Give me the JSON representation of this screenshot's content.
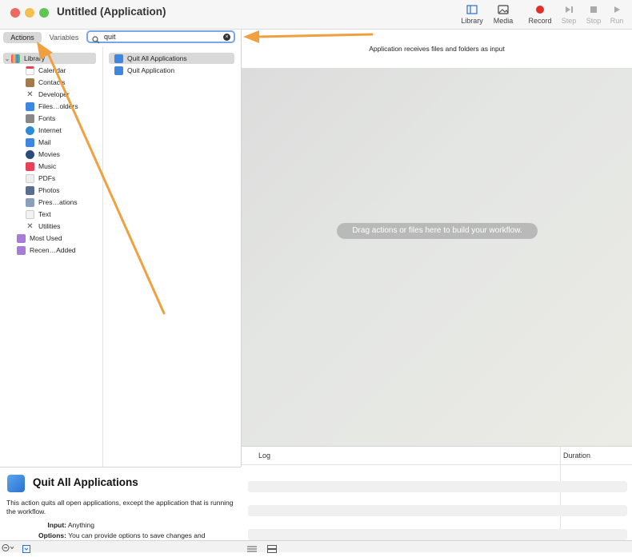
{
  "window": {
    "title": "Untitled (Application)"
  },
  "toolbar": {
    "library": "Library",
    "media": "Media",
    "record": "Record",
    "step": "Step",
    "stop": "Stop",
    "run": "Run"
  },
  "tabs": {
    "actions": "Actions",
    "variables": "Variables"
  },
  "search": {
    "value": "quit"
  },
  "library": {
    "root": "Library",
    "items": [
      {
        "label": "Calendar",
        "icon": "calendar-icon",
        "color": "#ffffff"
      },
      {
        "label": "Contacts",
        "icon": "contacts-icon",
        "color": "#a27a4d"
      },
      {
        "label": "Developer",
        "icon": "tools-icon",
        "color": "#666666"
      },
      {
        "label": "Files…olders",
        "icon": "finder-icon",
        "color": "#3f86e0"
      },
      {
        "label": "Fonts",
        "icon": "fonts-icon",
        "color": "#888888"
      },
      {
        "label": "Internet",
        "icon": "globe-icon",
        "color": "#2e8bd6"
      },
      {
        "label": "Mail",
        "icon": "mail-icon",
        "color": "#3f86e0"
      },
      {
        "label": "Movies",
        "icon": "movies-icon",
        "color": "#2c4a7a"
      },
      {
        "label": "Music",
        "icon": "music-icon",
        "color": "#e84258"
      },
      {
        "label": "PDFs",
        "icon": "pdf-icon",
        "color": "#d9d9d9"
      },
      {
        "label": "Photos",
        "icon": "photos-icon",
        "color": "#5b6d8f"
      },
      {
        "label": "Pres…ations",
        "icon": "presentations-icon",
        "color": "#8aa0b8"
      },
      {
        "label": "Text",
        "icon": "text-icon",
        "color": "#f2f2f2"
      },
      {
        "label": "Utilities",
        "icon": "utilities-icon",
        "color": "#666666"
      }
    ],
    "smart_groups": [
      {
        "label": "Most Used",
        "icon": "smart-folder-icon",
        "color": "#a77bd8"
      },
      {
        "label": "Recen…Added",
        "icon": "smart-folder-icon",
        "color": "#a77bd8"
      }
    ]
  },
  "actions": [
    {
      "label": "Quit All Applications",
      "selected": true
    },
    {
      "label": "Quit Application",
      "selected": false
    }
  ],
  "description": {
    "title": "Quit All Applications",
    "body": "This action quits all open applications, except the application that is running the workflow.",
    "input_label": "Input:",
    "input_value": "Anything",
    "options_label": "Options:",
    "options_value": "You can provide options to save changes and"
  },
  "workflow": {
    "header": "Application receives files and folders as input",
    "placeholder": "Drag actions or files here to build your workflow."
  },
  "log": {
    "col_log": "Log",
    "col_duration": "Duration"
  },
  "colors": {
    "annotation_arrow": "#f0a040",
    "record": "#e0302c",
    "search_focus": "#7aa6e6"
  }
}
